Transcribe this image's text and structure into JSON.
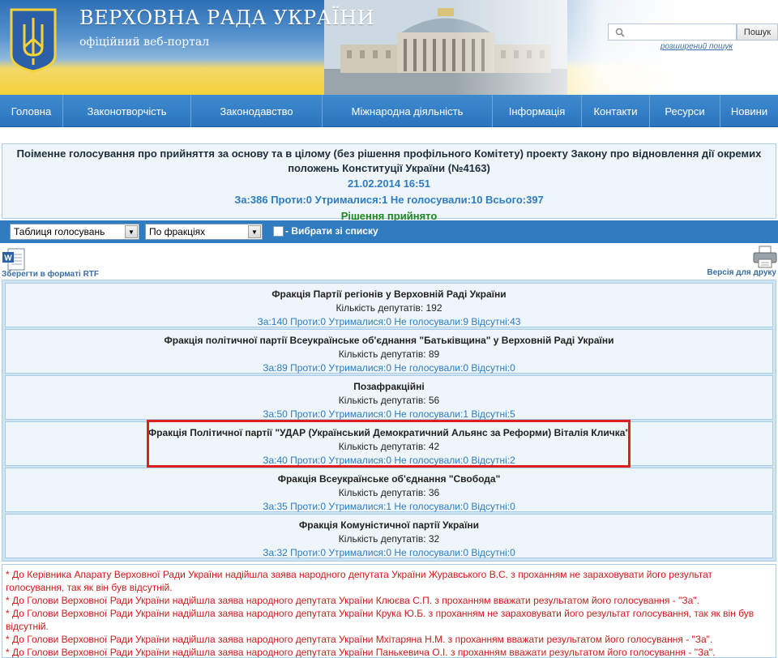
{
  "header": {
    "site_title": "ВЕРХОВНА РАДА УКРАЇНИ",
    "site_subtitle": "офіційний веб-портал",
    "search_placeholder": "",
    "search_button": "Пошук",
    "advanced_search": "розширений пошук"
  },
  "nav": [
    {
      "label": "Головна"
    },
    {
      "label": "Законотворчість"
    },
    {
      "label": "Законодавство"
    },
    {
      "label": "Міжнародна діяльність"
    },
    {
      "label": "Інформація"
    },
    {
      "label": "Контакти"
    },
    {
      "label": "Ресурси"
    },
    {
      "label": "Новини"
    }
  ],
  "vote": {
    "title": "Поіменне голосування про прийняття за основу та в цілому (без рішення профільного Комітету) проекту Закону про відновлення дії окремих положень Конституції України (№4163)",
    "datetime": "21.02.2014 16:51",
    "summary": "За:386 Проти:0 Утрималися:1 Не голосували:10 Всього:397",
    "decision": "Рішення прийнято"
  },
  "controls": {
    "view_select": "Таблиця голосувань",
    "group_select": "По фракціях",
    "choose_from_list": "- Вибрати зі списку"
  },
  "tools": {
    "save_rtf": "Зберегти в форматі RTF",
    "print_version": "Версія для друку"
  },
  "factions": [
    {
      "name": "Фракція Партії регіонів у Верховній Раді України",
      "count": "Кількість депутатів: 192",
      "result": "За:140 Проти:0 Утрималися:0 Не голосували:9 Відсутні:43"
    },
    {
      "name": "Фракція політичної партії Всеукраїнське об'єднання \"Батьківщина\" у Верховній Раді України",
      "count": "Кількість депутатів: 89",
      "result": "За:89 Проти:0 Утрималися:0 Не голосували:0 Відсутні:0"
    },
    {
      "name": "Позафракційні",
      "count": "Кількість депутатів: 56",
      "result": "За:50 Проти:0 Утрималися:0 Не голосували:1 Відсутні:5"
    },
    {
      "name": "Фракція Політичної партії \"УДАР (Український Демократичний Альянс за Реформи) Віталія Кличка\"",
      "count": "Кількість депутатів: 42",
      "result": "За:40 Проти:0 Утрималися:0 Не голосували:0 Відсутні:2"
    },
    {
      "name": "Фракція Всеукраїнське об'єднання \"Свобода\"",
      "count": "Кількість депутатів: 36",
      "result": "За:35 Проти:0 Утрималися:1 Не голосували:0 Відсутні:0"
    },
    {
      "name": "Фракція Комуністичної партії України",
      "count": "Кількість депутатів: 32",
      "result": "За:32 Проти:0 Утрималися:0 Не голосували:0 Відсутні:0"
    }
  ],
  "notes": [
    "* До Керівника Апарату Верховної Ради України надійшла заява народного депутата України Журавського В.С. з проханням не зараховувати його результат голосування, так як він був відсутній.",
    "* До Голови Верховної Ради України надійшла заява народного депутата України Клюєва С.П. з проханням вважати результатом його голосування - \"За\".",
    "* До Голови Верховної Ради України надійшла заява народного депутата України Крука Ю.Б. з проханням не зараховувати його результат голосування, так як він був відсутній.",
    "* До Голови Верховної Ради України надійшла заява народного депутата України Мхітаряна Н.М. з проханням вважати результатом його голосування - \"За\".",
    "* До Голови Верховної Ради України надійшла заява народного депутата України Панькевича О.І. з проханням вважати результатом його голосування - \"За\"."
  ],
  "colors": {
    "nav_blue": "#2f7cc0",
    "decision_green": "#1e8a1e",
    "note_red": "#d0191b",
    "highlight_red": "#e0201f"
  }
}
